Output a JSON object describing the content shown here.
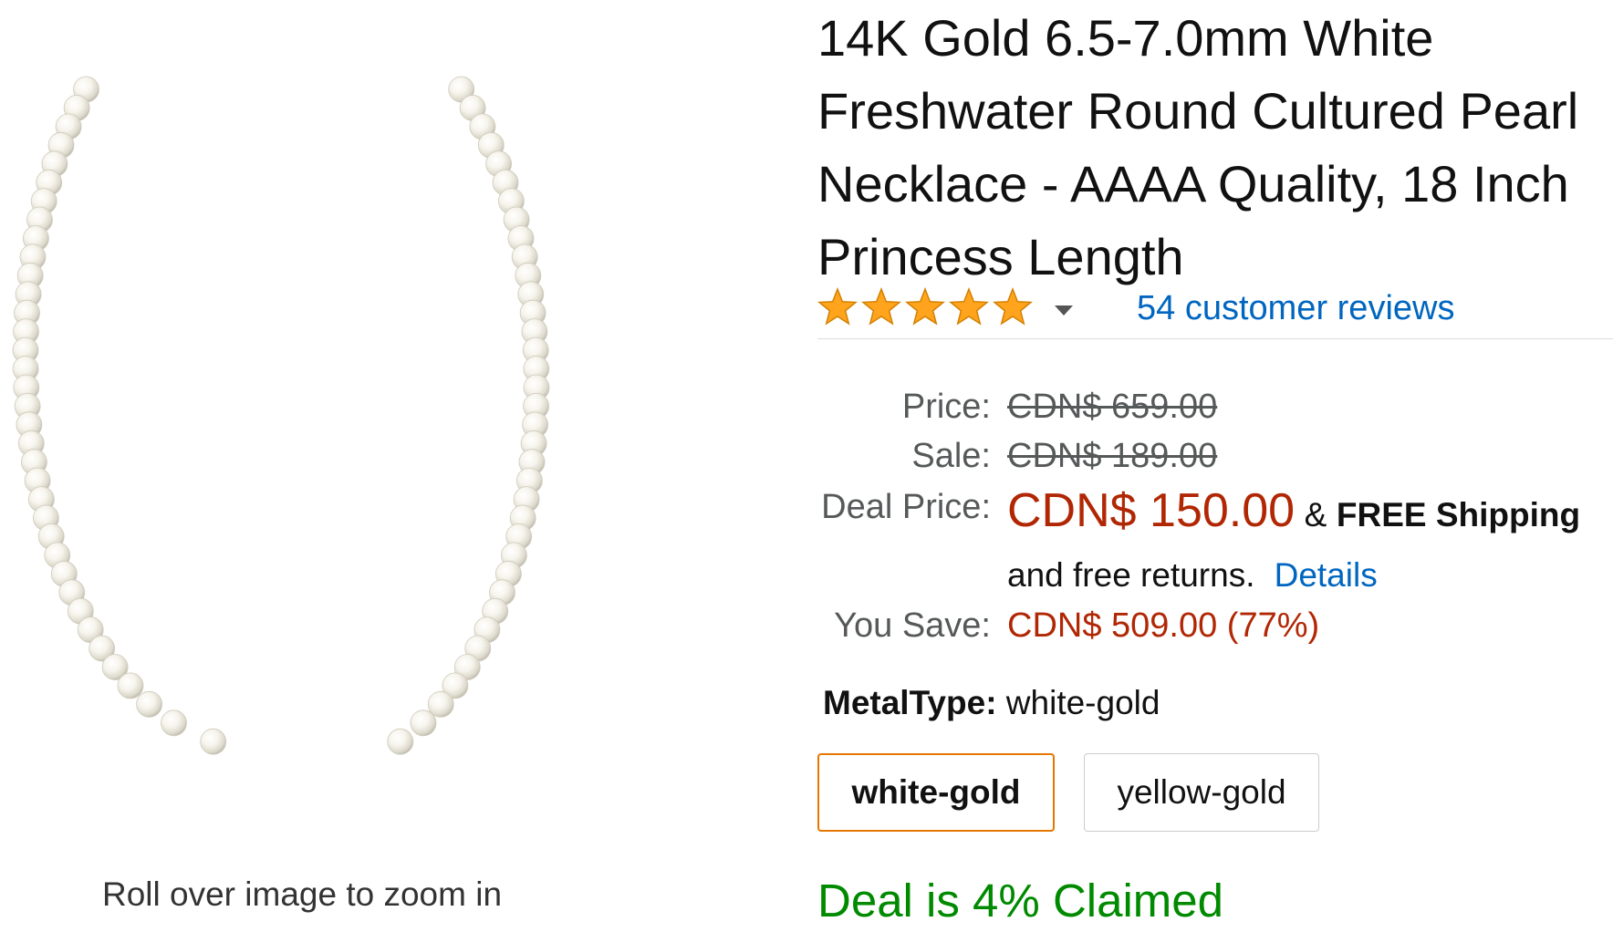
{
  "product": {
    "title": "14K Gold 6.5-7.0mm White Freshwater Round Cultured Pearl Necklace - AAAA Quality, 18 Inch Princess Length",
    "rating_stars": 5,
    "reviews_link": "54 customer reviews"
  },
  "image_panel": {
    "zoom_hint": "Roll over image to zoom in"
  },
  "pricing": {
    "price_label": "Price:",
    "price_value": "CDN$ 659.00",
    "sale_label": "Sale:",
    "sale_value": "CDN$ 189.00",
    "deal_label": "Deal Price:",
    "deal_value": "CDN$ 150.00",
    "amp": "&",
    "free_shipping": "FREE Shipping",
    "returns_text": "and free returns.",
    "details_link": "Details",
    "save_label": "You Save:",
    "save_value": "CDN$ 509.00 (77%)"
  },
  "variation": {
    "label": "MetalType:",
    "selected_value": "white-gold",
    "options": [
      "white-gold",
      "yellow-gold"
    ]
  },
  "deal_status": "Deal is 4% Claimed",
  "colors": {
    "link": "#0066c0",
    "price_red": "#b12704",
    "deal_green": "#008a00",
    "star": "#ffa41c",
    "selected_border": "#e77600"
  }
}
